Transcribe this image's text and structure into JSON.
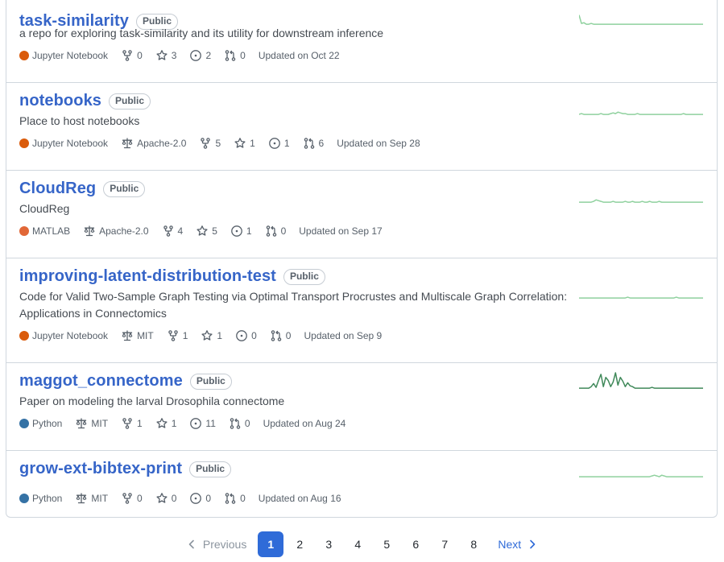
{
  "repos": [
    {
      "name": "task-similarity",
      "visibility": "Public",
      "description": "a repo for exploring task-similarity and its utility for downstream inference",
      "language": "Jupyter Notebook",
      "language_color": "#da5b0b",
      "license": "",
      "forks": "0",
      "stars": "3",
      "issues": "2",
      "pulls": "0",
      "updated": "Updated on Oct 22",
      "activity": [
        14,
        3,
        4,
        2,
        2,
        3,
        2,
        2,
        2,
        2,
        2,
        2,
        2,
        2,
        2,
        2,
        2,
        2,
        2,
        2,
        2,
        2,
        2,
        2,
        2,
        2,
        2,
        2,
        2,
        2,
        2,
        2,
        2,
        2,
        2,
        2,
        2,
        2,
        2,
        2,
        2,
        2,
        2,
        2,
        2,
        2,
        2,
        2,
        2,
        2,
        2,
        2
      ]
    },
    {
      "name": "notebooks",
      "visibility": "Public",
      "description": "Place to host notebooks",
      "language": "Jupyter Notebook",
      "language_color": "#da5b0b",
      "license": "Apache-2.0",
      "forks": "5",
      "stars": "1",
      "issues": "1",
      "pulls": "6",
      "updated": "Updated on Sep 28",
      "activity": [
        2,
        3,
        2,
        2,
        2,
        2,
        2,
        2,
        2,
        3,
        2,
        2,
        2,
        3,
        4,
        3,
        5,
        4,
        3,
        3,
        2,
        2,
        2,
        2,
        3,
        2,
        2,
        2,
        2,
        2,
        2,
        2,
        2,
        2,
        2,
        2,
        2,
        2,
        2,
        2,
        2,
        2,
        2,
        3,
        2,
        2,
        2,
        2,
        2,
        2,
        2,
        2
      ]
    },
    {
      "name": "CloudReg",
      "visibility": "Public",
      "description": "CloudReg",
      "language": "MATLAB",
      "language_color": "#e16737",
      "license": "Apache-2.0",
      "forks": "4",
      "stars": "5",
      "issues": "1",
      "pulls": "0",
      "updated": "Updated on Sep 17",
      "activity": [
        2,
        2,
        2,
        2,
        2,
        2,
        3,
        5,
        4,
        3,
        2,
        2,
        2,
        2,
        3,
        2,
        2,
        2,
        2,
        3,
        2,
        2,
        3,
        2,
        2,
        2,
        3,
        2,
        2,
        3,
        2,
        2,
        2,
        3,
        2,
        2,
        2,
        2,
        2,
        2,
        2,
        2,
        2,
        2,
        2,
        2,
        2,
        2,
        2,
        2,
        2,
        2
      ]
    },
    {
      "name": "improving-latent-distribution-test",
      "visibility": "Public",
      "description": "Code for Valid Two-Sample Graph Testing via Optimal Transport Procrustes and Multiscale Graph Correlation: Applications in Connectomics",
      "language": "Jupyter Notebook",
      "language_color": "#da5b0b",
      "license": "MIT",
      "forks": "1",
      "stars": "1",
      "issues": "0",
      "pulls": "0",
      "updated": "Updated on Sep 9",
      "activity": [
        2,
        2,
        2,
        2,
        2,
        2,
        2,
        2,
        2,
        2,
        2,
        2,
        2,
        2,
        2,
        2,
        2,
        2,
        2,
        2,
        3,
        2,
        2,
        2,
        2,
        2,
        2,
        2,
        2,
        2,
        2,
        2,
        2,
        2,
        2,
        2,
        2,
        2,
        2,
        2,
        3,
        2,
        2,
        2,
        2,
        2,
        2,
        2,
        2,
        2,
        2,
        2
      ]
    },
    {
      "name": "maggot_connectome",
      "visibility": "Public",
      "description": "Paper on modeling the larval Drosophila connectome",
      "language": "Python",
      "language_color": "#3572a5",
      "license": "MIT",
      "forks": "1",
      "stars": "1",
      "issues": "11",
      "pulls": "0",
      "updated": "Updated on Aug 24",
      "activity": [
        2,
        2,
        2,
        2,
        2,
        4,
        8,
        3,
        12,
        20,
        4,
        16,
        12,
        4,
        10,
        22,
        6,
        16,
        11,
        4,
        9,
        5,
        4,
        2,
        2,
        2,
        2,
        2,
        2,
        2,
        3,
        2,
        2,
        2,
        2,
        2,
        2,
        2,
        2,
        2,
        2,
        2,
        2,
        2,
        2,
        2,
        2,
        2,
        2,
        2,
        2,
        2
      ]
    },
    {
      "name": "grow-ext-bibtex-print",
      "visibility": "Public",
      "description": "",
      "language": "Python",
      "language_color": "#3572a5",
      "license": "MIT",
      "forks": "0",
      "stars": "0",
      "issues": "0",
      "pulls": "0",
      "updated": "Updated on Aug 16",
      "activity": [
        2,
        2,
        2,
        2,
        2,
        2,
        2,
        2,
        2,
        2,
        2,
        2,
        2,
        2,
        2,
        2,
        2,
        2,
        2,
        2,
        2,
        2,
        2,
        2,
        2,
        2,
        2,
        2,
        2,
        2,
        3,
        4,
        3,
        2,
        4,
        3,
        2,
        2,
        2,
        2,
        2,
        2,
        2,
        2,
        2,
        2,
        2,
        2,
        2,
        2,
        2,
        2
      ]
    }
  ],
  "pagination": {
    "previous": "Previous",
    "next": "Next",
    "current": "1",
    "pages": [
      "1",
      "2",
      "3",
      "4",
      "5",
      "6",
      "7",
      "8"
    ]
  },
  "colors": {
    "link": "#3665c8",
    "spark_line": "#2da44e",
    "page_current": "#2f6bd8"
  },
  "icons": {
    "fork": "repo-forked-icon",
    "star": "star-icon",
    "issue": "issue-opened-icon",
    "pull": "git-pull-request-icon",
    "license": "law-icon",
    "prev": "chevron-left-icon",
    "next": "chevron-right-icon"
  }
}
